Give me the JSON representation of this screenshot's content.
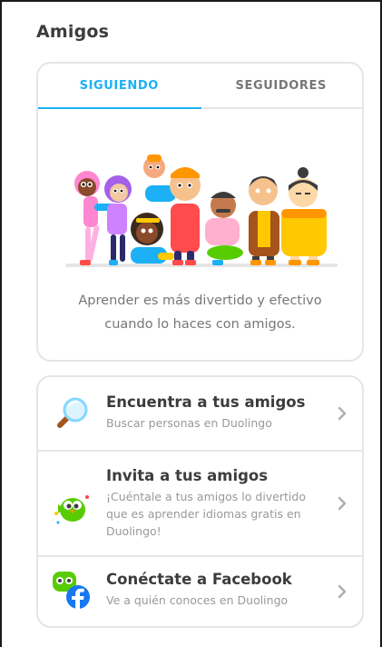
{
  "page": {
    "title": "Amigos"
  },
  "tabs": [
    {
      "label": "SIGUIENDO",
      "active": true
    },
    {
      "label": "SEGUIDORES",
      "active": false
    }
  ],
  "empty_state": {
    "message": "Aprender es más divertido y efectivo cuando lo haces con amigos."
  },
  "actions": [
    {
      "title": "Encuentra a tus amigos",
      "subtitle": "Buscar personas en Duolingo",
      "icon": "magnifier-icon"
    },
    {
      "title": "Invita a tus amigos",
      "subtitle": "¡Cuéntale a tus amigos lo divertido que es aprender idiomas gratis en Duolingo!",
      "icon": "duo-owl-icon"
    },
    {
      "title": "Conéctate a Facebook",
      "subtitle": "Ve a quién conoces en Duolingo",
      "icon": "facebook-duo-icon"
    }
  ],
  "colors": {
    "accent": "#1cb0f6",
    "border": "#e5e5e5",
    "duo_green": "#58cc02",
    "facebook": "#1877f2"
  }
}
